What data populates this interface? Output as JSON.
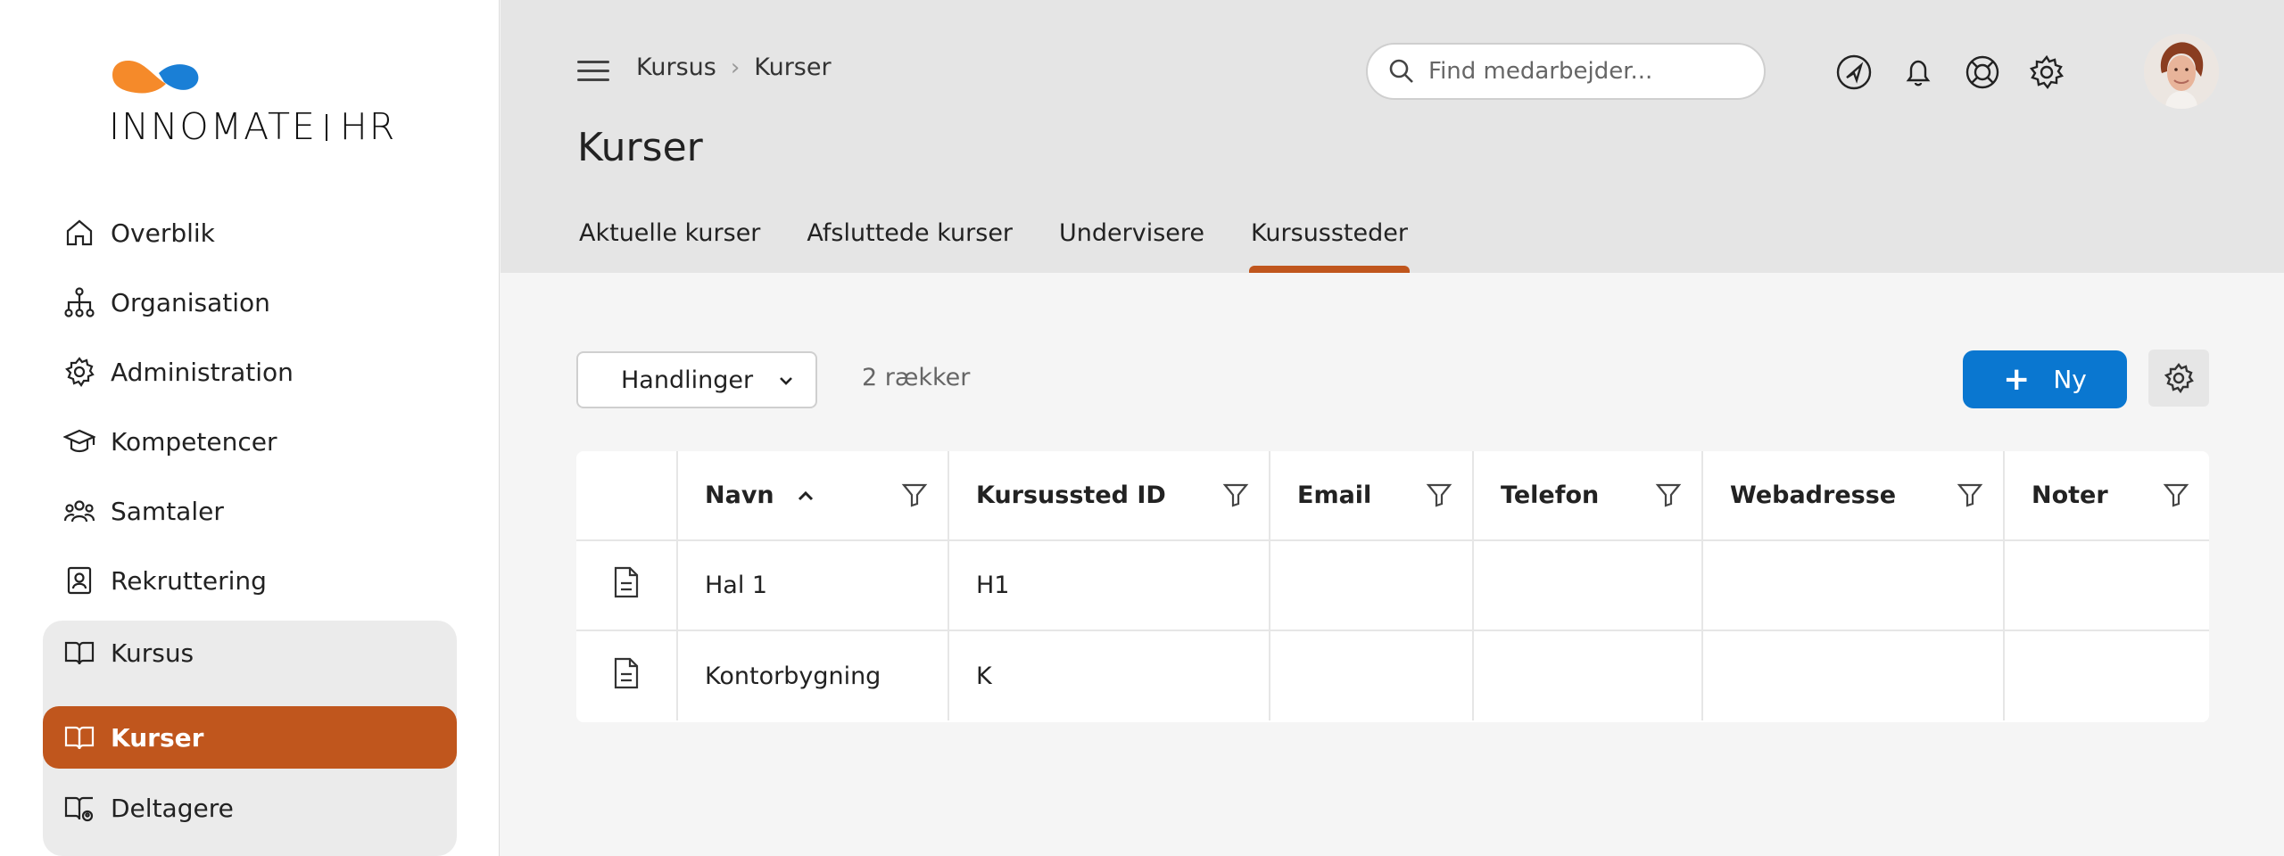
{
  "logo": {
    "brand": "INNOMATE",
    "product": "HR",
    "colors": {
      "orange": "#f58a2a",
      "blue": "#1a7fd6"
    }
  },
  "sidebar": {
    "items": [
      {
        "label": "Overblik",
        "icon": "home-icon"
      },
      {
        "label": "Organisation",
        "icon": "org-chart-icon"
      },
      {
        "label": "Administration",
        "icon": "gear-icon"
      },
      {
        "label": "Kompetencer",
        "icon": "graduation-cap-icon"
      },
      {
        "label": "Samtaler",
        "icon": "people-icon"
      },
      {
        "label": "Rekruttering",
        "icon": "id-badge-icon"
      }
    ],
    "group": {
      "parent": {
        "label": "Kursus",
        "icon": "book-icon"
      },
      "children": [
        {
          "label": "Kurser",
          "icon": "book-icon",
          "active": true
        },
        {
          "label": "Deltagere",
          "icon": "book-user-icon"
        }
      ]
    }
  },
  "header": {
    "breadcrumb": [
      "Kursus",
      "Kurser"
    ],
    "title": "Kurser",
    "search_placeholder": "Find medarbejder...",
    "icons": [
      "navigation-icon",
      "bell-icon",
      "lifebuoy-icon",
      "settings-icon"
    ],
    "tabs": [
      {
        "label": "Aktuelle kurser",
        "active": false
      },
      {
        "label": "Afsluttede kurser",
        "active": false
      },
      {
        "label": "Undervisere",
        "active": false
      },
      {
        "label": "Kursussteder",
        "active": true
      }
    ]
  },
  "toolbar": {
    "actions_label": "Handlinger",
    "row_count": "2 rækker",
    "new_label": "Ny"
  },
  "table": {
    "columns": [
      "Navn",
      "Kursussted ID",
      "Email",
      "Telefon",
      "Webadresse",
      "Noter"
    ],
    "sorted_column": "Navn",
    "sort_direction": "asc",
    "rows": [
      {
        "navn": "Hal 1",
        "id": "H1",
        "email": "",
        "telefon": "",
        "webadresse": "",
        "noter": ""
      },
      {
        "navn": "Kontorbygning",
        "id": "K",
        "email": "",
        "telefon": "",
        "webadresse": "",
        "noter": ""
      }
    ]
  },
  "colors": {
    "accent": "#c0561d",
    "primary_button": "#0a77d0",
    "header_bg": "#e5e5e5"
  }
}
